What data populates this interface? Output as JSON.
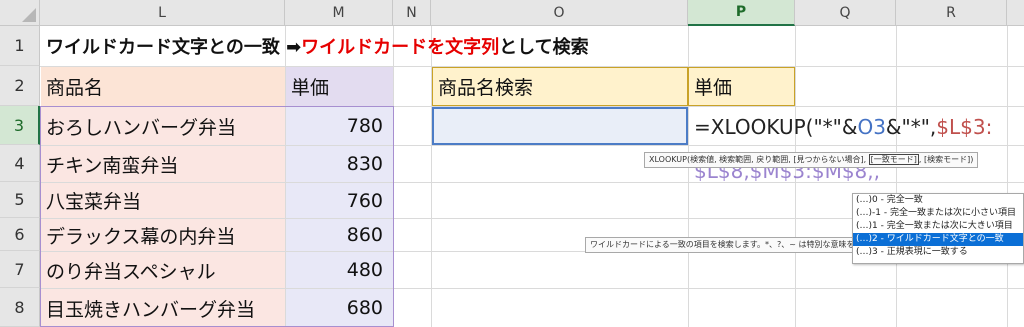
{
  "columns": {
    "L": "L",
    "M": "M",
    "N": "N",
    "O": "O",
    "P": "P",
    "Q": "Q",
    "R": "R"
  },
  "rows": [
    "1",
    "2",
    "3",
    "4",
    "5",
    "6",
    "7",
    "8"
  ],
  "title": {
    "part1": "ワイルドカード文字との一致 ➡ ",
    "part2": "ワイルドカードを文字列",
    "part3": "として検索"
  },
  "table": {
    "header_name": "商品名",
    "header_price": "単価",
    "items": [
      {
        "name": "おろしハンバーグ弁当",
        "price": "780"
      },
      {
        "name": "チキン南蛮弁当",
        "price": "830"
      },
      {
        "name": "八宝菜弁当",
        "price": "760"
      },
      {
        "name": "デラックス幕の内弁当",
        "price": "860"
      },
      {
        "name": "のり弁当スペシャル",
        "price": "480"
      },
      {
        "name": "目玉焼きハンバーグ弁当",
        "price": "680"
      }
    ]
  },
  "search": {
    "label": "商品名検索",
    "price_label": "単価",
    "value": ""
  },
  "formula": {
    "prefix": "=XLOOKUP(\"*\"&",
    "ref1": "O3",
    "mid": "&\"*\",",
    "ref2": "$L$3:",
    "line2": "$L$8,$M$3:$M$8,,"
  },
  "tooltip": {
    "args": "XLOOKUP(検索値, 検索範囲, 戻り範囲, [見つからない場合], ",
    "current": "[一致モード]",
    "rest": ", [検索モード])"
  },
  "hint": "ワイルドカードによる一致の項目を検索します。*、?、~ は特別な意味を持ちます",
  "dropdown": [
    {
      "label": "(…)0 - 完全一致"
    },
    {
      "label": "(…)-1 - 完全一致または次に小さい項目"
    },
    {
      "label": "(…)1 - 完全一致または次に大きい項目"
    },
    {
      "label": "(…)2 - ワイルドカード文字との一致"
    },
    {
      "label": "(…)3 - 正規表現に一致する"
    }
  ],
  "colors": {
    "accent": "#217346",
    "highlight": "#0b6fd6",
    "title_red": "#e60000"
  }
}
